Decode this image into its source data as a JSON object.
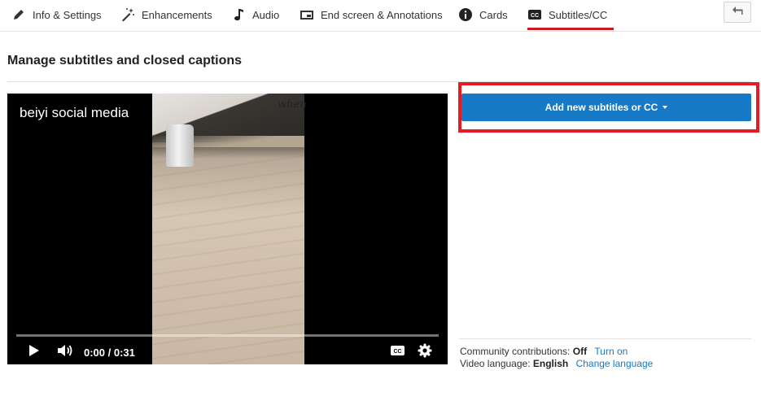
{
  "tabs": [
    {
      "label": "Info & Settings",
      "icon": "pencil-icon"
    },
    {
      "label": "Enhancements",
      "icon": "magic-wand-icon"
    },
    {
      "label": "Audio",
      "icon": "music-note-icon"
    },
    {
      "label": "End screen & Annotations",
      "icon": "end-screen-icon"
    },
    {
      "label": "Cards",
      "icon": "info-icon"
    },
    {
      "label": "Subtitles/CC",
      "icon": "cc-icon",
      "active": true
    }
  ],
  "page": {
    "title": "Manage subtitles and closed captions"
  },
  "player": {
    "channel_name": "beiyi social media",
    "overlay_text": "when",
    "time": "0:00 / 0:31",
    "progress": 0
  },
  "add_button": {
    "label": "Add new subtitles or CC"
  },
  "meta": {
    "community_label": "Community contributions:",
    "community_value": "Off",
    "community_link": "Turn on",
    "language_label": "Video language:",
    "language_value": "English",
    "language_link": "Change language"
  },
  "colors": {
    "accent_blue": "#167ac6",
    "active_tab_underline": "#cc181e",
    "highlight_box": "#e31b23"
  }
}
